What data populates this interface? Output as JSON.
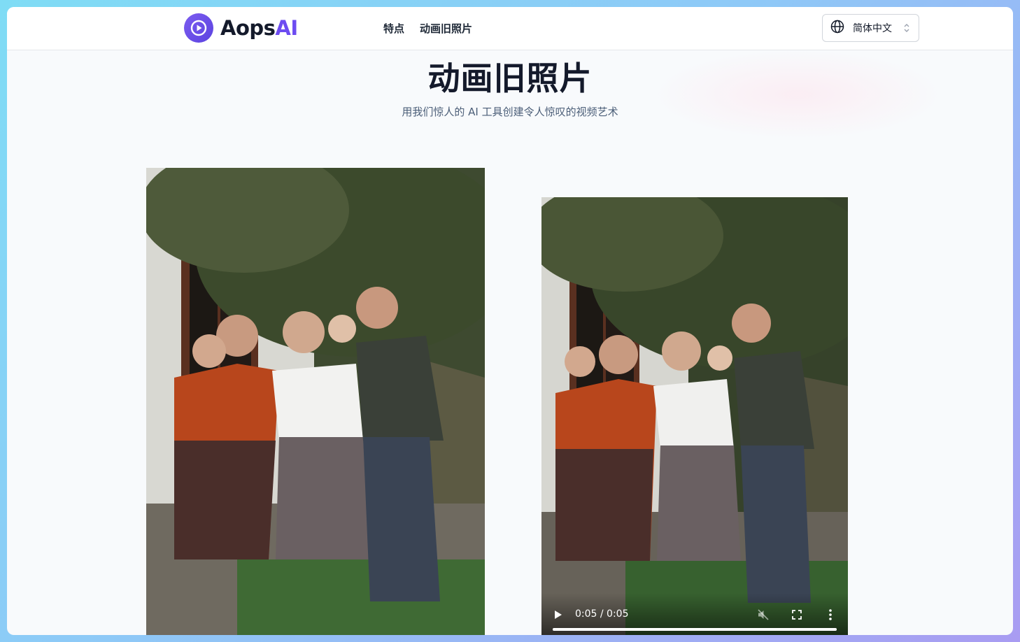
{
  "brand": {
    "name_part1": "Aops",
    "name_part2": "AI",
    "accent": "#6d4cf1"
  },
  "nav": {
    "items": [
      "特点",
      "动画旧照片"
    ]
  },
  "language": {
    "label": "简体中文"
  },
  "hero": {
    "title": "动画旧照片",
    "subtitle": "用我们惊人的 AI 工具创建令人惊叹的视频艺术"
  },
  "video": {
    "time": "0:05 / 0:05",
    "progress": 1.0
  },
  "icons": [
    "play-circle-logo-icon",
    "globe-icon",
    "chevron-updown-icon",
    "play-icon",
    "mute-icon",
    "fullscreen-icon",
    "more-vertical-icon"
  ]
}
